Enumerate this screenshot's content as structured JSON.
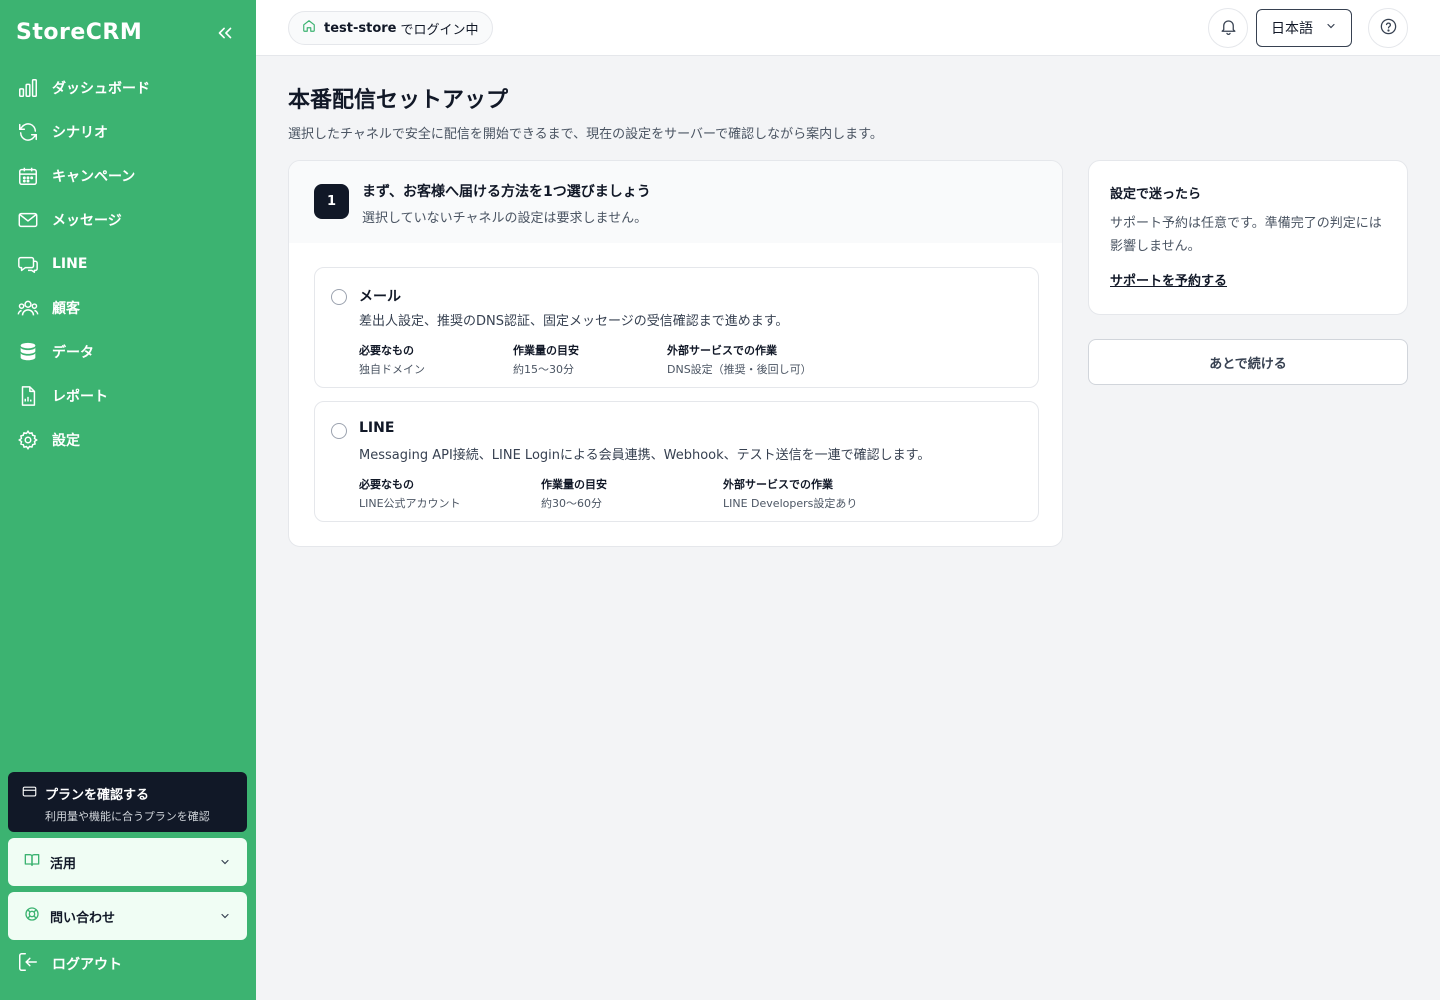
{
  "sidebar": {
    "brand": "StoreCRM",
    "items": [
      {
        "label": "ダッシュボード",
        "icon": "bar-chart-icon"
      },
      {
        "label": "シナリオ",
        "icon": "refresh-icon"
      },
      {
        "label": "キャンペーン",
        "icon": "calendar-icon"
      },
      {
        "label": "メッセージ",
        "icon": "mail-icon"
      },
      {
        "label": "LINE",
        "icon": "chat-icon"
      },
      {
        "label": "顧客",
        "icon": "users-icon"
      },
      {
        "label": "データ",
        "icon": "database-icon"
      },
      {
        "label": "レポート",
        "icon": "report-icon"
      },
      {
        "label": "設定",
        "icon": "gear-icon"
      }
    ],
    "plan": {
      "title": "プランを確認する",
      "subtitle": "利用量や機能に合うプランを確認"
    },
    "usage": {
      "label": "活用"
    },
    "contact": {
      "label": "問い合わせ"
    },
    "logout": {
      "label": "ログアウト"
    }
  },
  "header": {
    "store_name": "test-store",
    "store_suffix": "でログイン中",
    "language": "日本語"
  },
  "main": {
    "title": "本番配信セットアップ",
    "description": "選択したチャネルで安全に配信を開始できるまで、現在の設定をサーバーで確認しながら案内します。",
    "step": {
      "number": "1",
      "title": "まず、お客様へ届ける方法を1つ選びましょう",
      "subtitle": "選択していないチャネルの設定は要求しません。"
    },
    "options": [
      {
        "name": "メール",
        "description": "差出人設定、推奨のDNS認証、固定メッセージの受信確認まで進めます。",
        "meta": [
          {
            "key": "必要なもの",
            "value": "独自ドメイン"
          },
          {
            "key": "作業量の目安",
            "value": "約15〜30分"
          },
          {
            "key": "外部サービスでの作業",
            "value": "DNS設定（推奨・後回し可）"
          }
        ]
      },
      {
        "name": "LINE",
        "description": "Messaging API接続、LINE Loginによる会員連携、Webhook、テスト送信を一連で確認します。",
        "meta": [
          {
            "key": "必要なもの",
            "value": "LINE公式アカウント"
          },
          {
            "key": "作業量の目安",
            "value": "約30〜60分"
          },
          {
            "key": "外部サービスでの作業",
            "value": "LINE Developers設定あり"
          }
        ]
      }
    ]
  },
  "aside": {
    "title": "設定で迷ったら",
    "body": "サポート予約は任意です。準備完了の判定には影響しません。",
    "link": "サポートを予約する",
    "later_button": "あとで続ける"
  },
  "colors": {
    "sidebar": "#3cb371",
    "dark": "#111827",
    "border": "#e5e7eb"
  }
}
